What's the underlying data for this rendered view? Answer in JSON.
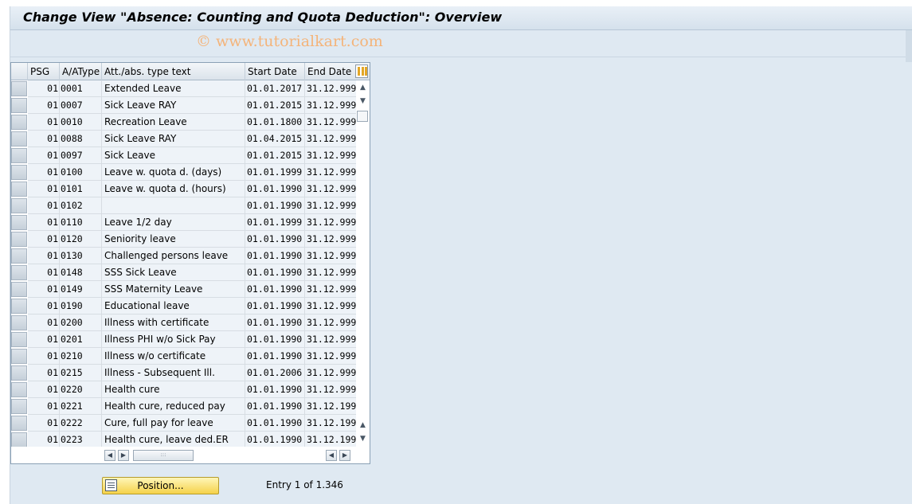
{
  "window": {
    "title": "Change View \"Absence: Counting and Quota Deduction\": Overview",
    "watermark": "© www.tutorialkart.com"
  },
  "table": {
    "columns": [
      "PSG",
      "A/AType",
      "Att./abs. type text",
      "Start Date",
      "End Date"
    ],
    "rows": [
      {
        "psg": "01",
        "type": "0001",
        "text": "Extended Leave",
        "start": "01.01.2017",
        "end": "31.12.999"
      },
      {
        "psg": "01",
        "type": "0007",
        "text": "Sick Leave RAY",
        "start": "01.01.2015",
        "end": "31.12.999"
      },
      {
        "psg": "01",
        "type": "0010",
        "text": "Recreation Leave",
        "start": "01.01.1800",
        "end": "31.12.999"
      },
      {
        "psg": "01",
        "type": "0088",
        "text": "Sick Leave RAY",
        "start": "01.04.2015",
        "end": "31.12.999"
      },
      {
        "psg": "01",
        "type": "0097",
        "text": "Sick Leave",
        "start": "01.01.2015",
        "end": "31.12.999"
      },
      {
        "psg": "01",
        "type": "0100",
        "text": "Leave w. quota d. (days)",
        "start": "01.01.1999",
        "end": "31.12.999"
      },
      {
        "psg": "01",
        "type": "0101",
        "text": "Leave w. quota d. (hours)",
        "start": "01.01.1990",
        "end": "31.12.999"
      },
      {
        "psg": "01",
        "type": "0102",
        "text": "",
        "start": "01.01.1990",
        "end": "31.12.999"
      },
      {
        "psg": "01",
        "type": "0110",
        "text": "Leave 1/2 day",
        "start": "01.01.1999",
        "end": "31.12.999"
      },
      {
        "psg": "01",
        "type": "0120",
        "text": "Seniority leave",
        "start": "01.01.1990",
        "end": "31.12.999"
      },
      {
        "psg": "01",
        "type": "0130",
        "text": "Challenged persons leave",
        "start": "01.01.1990",
        "end": "31.12.999"
      },
      {
        "psg": "01",
        "type": "0148",
        "text": "SSS Sick Leave",
        "start": "01.01.1990",
        "end": "31.12.999"
      },
      {
        "psg": "01",
        "type": "0149",
        "text": "SSS Maternity Leave",
        "start": "01.01.1990",
        "end": "31.12.999"
      },
      {
        "psg": "01",
        "type": "0190",
        "text": "Educational leave",
        "start": "01.01.1990",
        "end": "31.12.999"
      },
      {
        "psg": "01",
        "type": "0200",
        "text": "Illness with certificate",
        "start": "01.01.1990",
        "end": "31.12.999"
      },
      {
        "psg": "01",
        "type": "0201",
        "text": "Illness PHI w/o Sick Pay",
        "start": "01.01.1990",
        "end": "31.12.999"
      },
      {
        "psg": "01",
        "type": "0210",
        "text": "Illness w/o certificate",
        "start": "01.01.1990",
        "end": "31.12.999"
      },
      {
        "psg": "01",
        "type": "0215",
        "text": "Illness - Subsequent Ill.",
        "start": "01.01.2006",
        "end": "31.12.999"
      },
      {
        "psg": "01",
        "type": "0220",
        "text": "Health cure",
        "start": "01.01.1990",
        "end": "31.12.999"
      },
      {
        "psg": "01",
        "type": "0221",
        "text": "Health cure, reduced pay",
        "start": "01.01.1990",
        "end": "31.12.199"
      },
      {
        "psg": "01",
        "type": "0222",
        "text": "Cure, full pay for leave",
        "start": "01.01.1990",
        "end": "31.12.199"
      },
      {
        "psg": "01",
        "type": "0223",
        "text": "Health cure, leave ded.ER",
        "start": "01.01.1990",
        "end": "31.12.199"
      }
    ]
  },
  "footer": {
    "position_label": "Position...",
    "entry_text": "Entry 1 of 1.346"
  },
  "colors": {
    "accent": "#f5d24a",
    "header_bg": "#dfe9f2"
  }
}
